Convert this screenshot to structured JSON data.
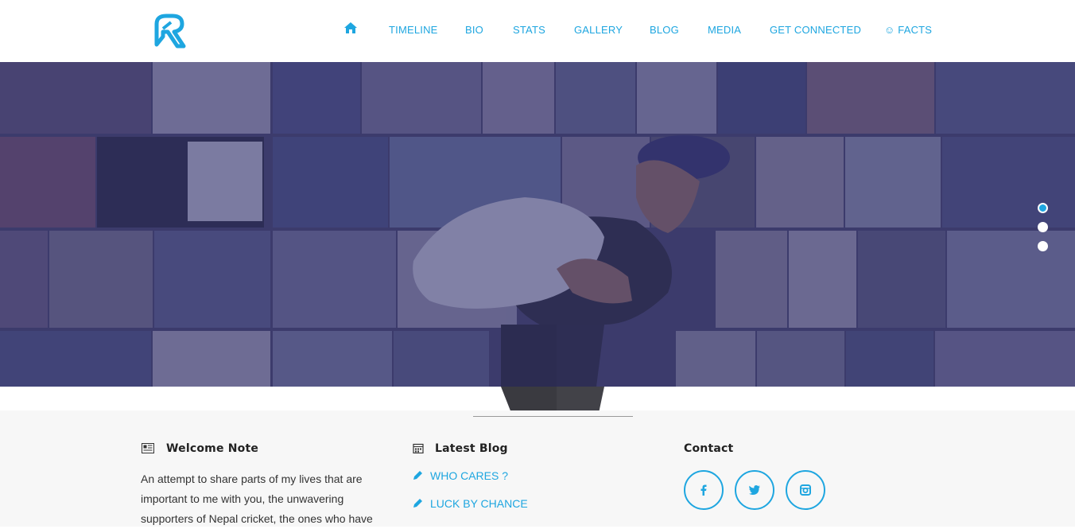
{
  "header": {
    "logo_icon": "pk-logo-icon",
    "home_icon": "home-icon",
    "nav": [
      {
        "label": "TIMELINE"
      },
      {
        "label": "BIO"
      },
      {
        "label": "STATS"
      },
      {
        "label": "GALLERY"
      },
      {
        "label": "BLOG"
      },
      {
        "label": "MEDIA"
      },
      {
        "label": "GET CONNECTED"
      },
      {
        "label": "☺ FACTS"
      }
    ]
  },
  "hero": {
    "slider_dots": 3,
    "active_dot": 0
  },
  "welcome": {
    "title": "Welcome Note",
    "icon": "newspaper-icon",
    "lines": [
      "An attempt to share parts of my lives that are",
      "important to me with you, the unwavering",
      "supporters of Nepal cricket, the ones who have"
    ]
  },
  "blog": {
    "title": "Latest Blog",
    "icon": "calendar-icon",
    "posts": [
      {
        "label": "WHO CARES ?"
      },
      {
        "label": "LUCK BY CHANCE"
      }
    ]
  },
  "contact": {
    "title": "Contact",
    "social": [
      "facebook-icon",
      "twitter-icon",
      "instagram-icon"
    ]
  },
  "colors": {
    "accent": "#1ea6e0",
    "hero_tint": "#2d2e6e",
    "footer_bg": "#f7f7f7"
  }
}
